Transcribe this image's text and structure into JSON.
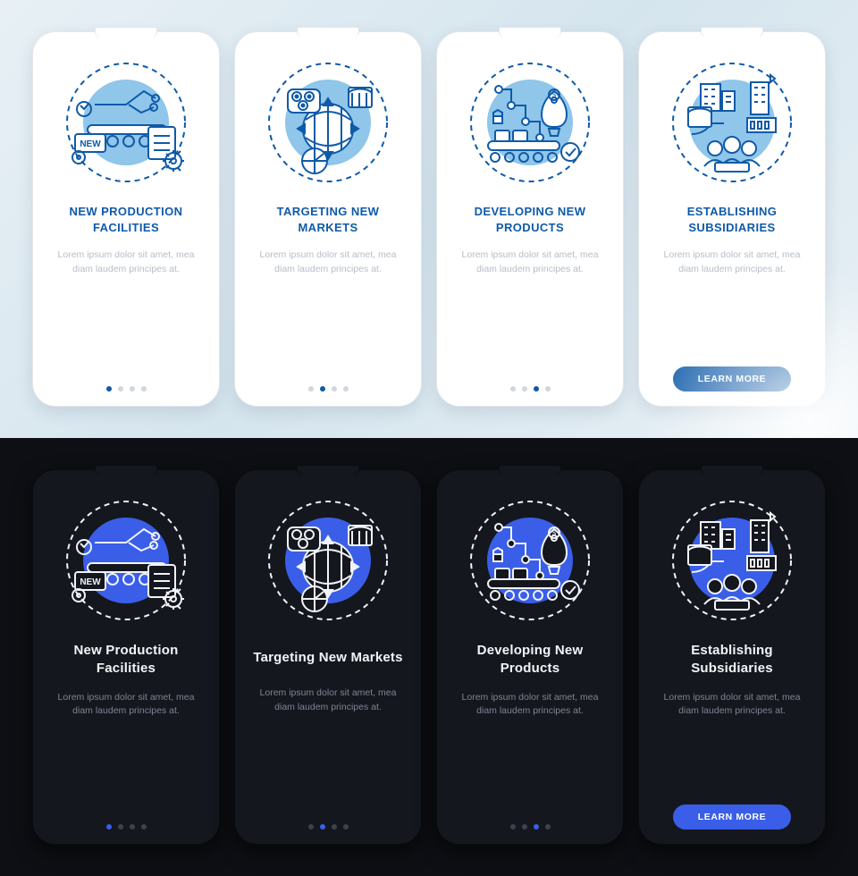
{
  "colors": {
    "light_primary": "#0f5aa8",
    "light_accent": "#6fb9e6",
    "dark_primary": "#3a5ee8",
    "dark_stroke": "#f1f3f8"
  },
  "lorem": "Lorem ipsum dolor sit amet, mea diam laudem principes at.",
  "button_label": "LEARN MORE",
  "light_cards": [
    {
      "title": "NEW PRODUCTION FACILITIES",
      "icon": "production"
    },
    {
      "title": "TARGETING NEW MARKETS",
      "icon": "markets"
    },
    {
      "title": "DEVELOPING NEW PRODUCTS",
      "icon": "products"
    },
    {
      "title": "ESTABLISHING SUBSIDIARIES",
      "icon": "subsidiaries"
    }
  ],
  "dark_cards": [
    {
      "title": "New Production Facilities",
      "icon": "production"
    },
    {
      "title": "Targeting New Markets",
      "icon": "markets"
    },
    {
      "title": "Developing New Products",
      "icon": "products"
    },
    {
      "title": "Establishing Subsidiaries",
      "icon": "subsidiaries"
    }
  ]
}
